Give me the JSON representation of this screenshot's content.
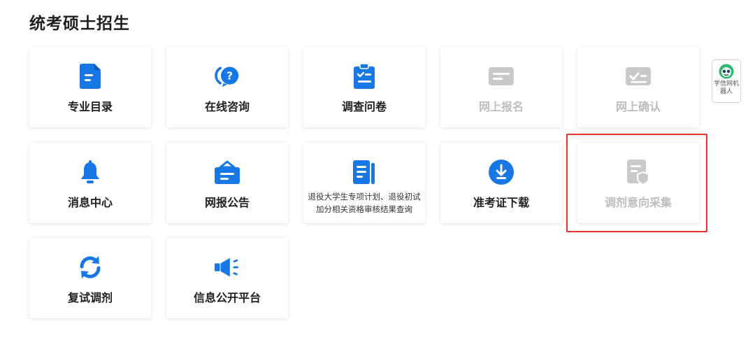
{
  "page": {
    "title": "统考硕士招生"
  },
  "colors": {
    "accent": "#1677e5",
    "disabled": "#c9c9c9",
    "highlight": "#e5322d"
  },
  "cards": [
    {
      "label": "专业目录",
      "icon": "document-list-icon",
      "enabled": true
    },
    {
      "label": "在线咨询",
      "icon": "chat-question-icon",
      "enabled": true
    },
    {
      "label": "调查问卷",
      "icon": "clipboard-checklist-icon",
      "enabled": true
    },
    {
      "label": "网上报名",
      "icon": "form-card-icon",
      "enabled": false
    },
    {
      "label": "网上确认",
      "icon": "check-card-icon",
      "enabled": false
    },
    {
      "label": "消息中心",
      "icon": "bell-icon",
      "enabled": true
    },
    {
      "label": "网报公告",
      "icon": "briefcase-announcement-icon",
      "enabled": true
    },
    {
      "label": "退役大学生专项计划、退役初试加分相关资格审核结果查询",
      "icon": "document-lines-icon",
      "enabled": true
    },
    {
      "label": "准考证下载",
      "icon": "download-circle-icon",
      "enabled": true
    },
    {
      "label": "调剂意向采集",
      "icon": "document-shield-icon",
      "enabled": false
    },
    {
      "label": "复试调剂",
      "icon": "refresh-icon",
      "enabled": true
    },
    {
      "label": "信息公开平台",
      "icon": "megaphone-icon",
      "enabled": true
    }
  ],
  "robot": {
    "label": "学信网机器人"
  }
}
